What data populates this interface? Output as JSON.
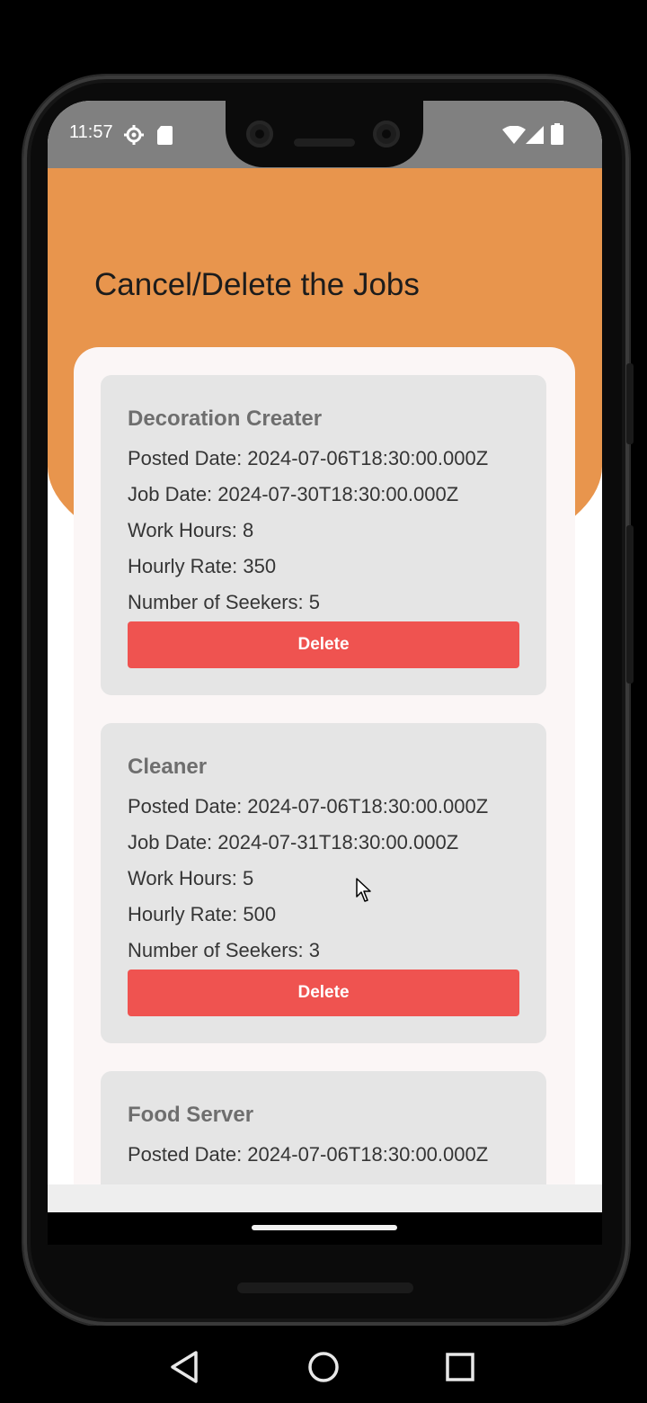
{
  "status_bar": {
    "time": "11:57",
    "icons": [
      "settings-icon",
      "sd-card-icon",
      "wifi-icon",
      "signal-icon",
      "battery-icon"
    ]
  },
  "page": {
    "title": "Cancel/Delete the Jobs"
  },
  "colors": {
    "header": "#e8954d",
    "delete_button": "#ef5350",
    "card": "#e5e5e5",
    "container": "#fbf6f6"
  },
  "jobs": [
    {
      "title": "Decoration Creater",
      "posted": "Posted Date: 2024-07-06T18:30:00.000Z",
      "job_date": "Job Date: 2024-07-30T18:30:00.000Z",
      "hours": "Work Hours: 8",
      "rate": "Hourly Rate: 350",
      "seekers": "Number of Seekers: 5",
      "delete_label": "Delete"
    },
    {
      "title": "Cleaner",
      "posted": "Posted Date: 2024-07-06T18:30:00.000Z",
      "job_date": "Job Date: 2024-07-31T18:30:00.000Z",
      "hours": "Work Hours: 5",
      "rate": "Hourly Rate: 500",
      "seekers": "Number of Seekers: 3",
      "delete_label": "Delete"
    },
    {
      "title": "Food Server",
      "posted": "Posted Date: 2024-07-06T18:30:00.000Z"
    }
  ],
  "navigation": {
    "icons": [
      "back-icon",
      "home-icon",
      "recents-icon"
    ]
  }
}
